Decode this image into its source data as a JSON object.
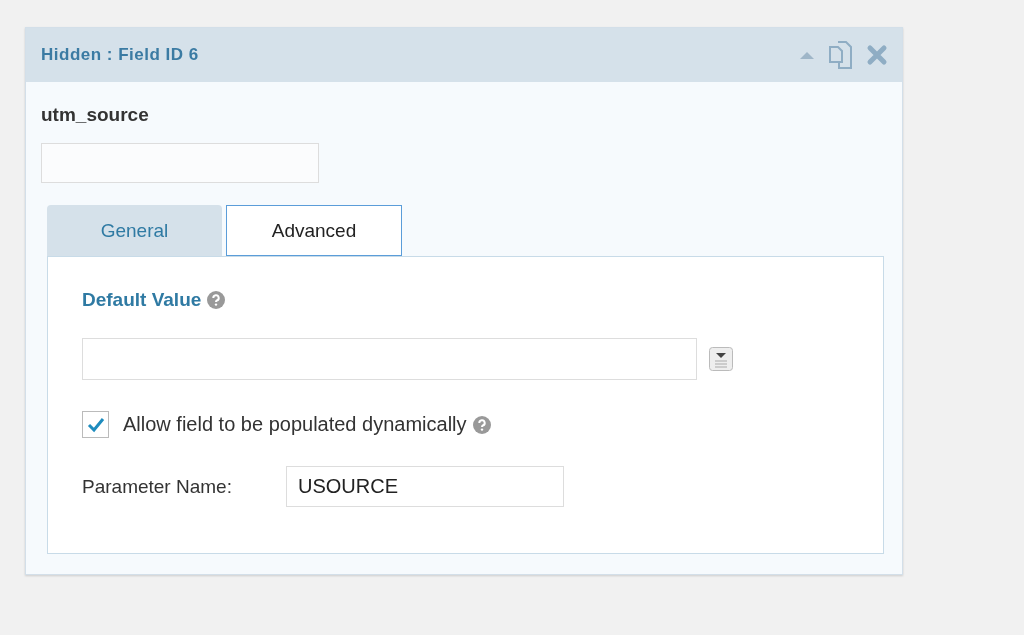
{
  "panel": {
    "title": "Hidden : Field ID 6"
  },
  "field": {
    "label": "utm_source"
  },
  "tabs": [
    {
      "label": "General",
      "selected": false
    },
    {
      "label": "Advanced",
      "selected": true
    }
  ],
  "advanced": {
    "default_value_label": "Default Value",
    "dynamic": {
      "label": "Allow field to be populated dynamically",
      "checked": true
    },
    "parameter": {
      "label": "Parameter Name:",
      "value": "USOURCE"
    }
  }
}
